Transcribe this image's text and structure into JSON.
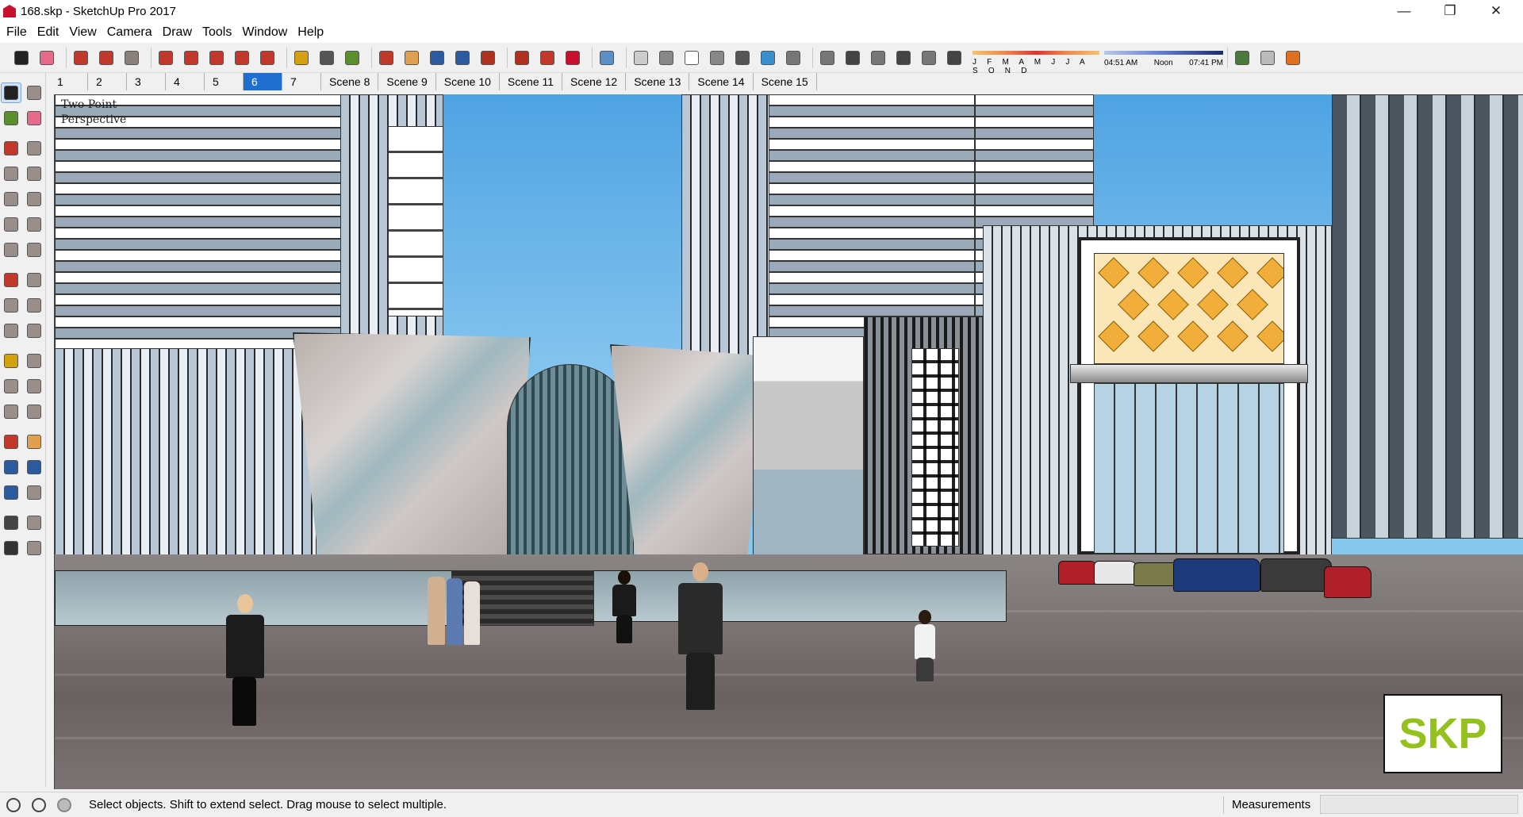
{
  "window": {
    "title": "168.skp - SketchUp Pro 2017",
    "minimize_glyph": "—",
    "maximize_glyph": "❐",
    "close_glyph": "✕"
  },
  "menu": [
    "File",
    "Edit",
    "View",
    "Camera",
    "Draw",
    "Tools",
    "Window",
    "Help"
  ],
  "toolbar": {
    "icons": [
      {
        "name": "select-icon",
        "color": "#222222"
      },
      {
        "name": "eraser-icon",
        "color": "#e46b8a"
      },
      {
        "name": "line-icon",
        "color": "#c0392b"
      },
      {
        "name": "arc-icon",
        "color": "#c0392b"
      },
      {
        "name": "rectangle-icon",
        "color": "#8a7f7b"
      },
      {
        "name": "push-pull-icon",
        "color": "#c0392b"
      },
      {
        "name": "follow-me-icon",
        "color": "#c0392b"
      },
      {
        "name": "move-icon",
        "color": "#c0392b"
      },
      {
        "name": "rotate-icon",
        "color": "#c0392b"
      },
      {
        "name": "scale-icon",
        "color": "#c0392b"
      },
      {
        "name": "tape-measure-icon",
        "color": "#d4a10f"
      },
      {
        "name": "text-icon",
        "color": "#555555"
      },
      {
        "name": "paint-bucket-icon",
        "color": "#5a8f2e"
      },
      {
        "name": "orbit-icon",
        "color": "#c0392b"
      },
      {
        "name": "pan-icon",
        "color": "#e0a050"
      },
      {
        "name": "zoom-icon",
        "color": "#2c5aa0"
      },
      {
        "name": "zoom-extents-icon",
        "color": "#2c5aa0"
      },
      {
        "name": "warehouse-icon",
        "color": "#b03020"
      },
      {
        "name": "extension-warehouse-icon",
        "color": "#b03020"
      },
      {
        "name": "layout-icon",
        "color": "#c0392b"
      },
      {
        "name": "ruby-icon",
        "color": "#c8102e"
      },
      {
        "name": "xray-icon",
        "color": "#5a8fc8"
      },
      {
        "name": "back-edges-icon",
        "color": "#cccccc"
      },
      {
        "name": "wireframe-icon",
        "color": "#888888"
      },
      {
        "name": "hidden-line-icon",
        "color": "#ffffff"
      },
      {
        "name": "shaded-icon",
        "color": "#888888"
      },
      {
        "name": "shaded-textures-icon",
        "color": "#555555"
      },
      {
        "name": "monochrome-icon",
        "color": "#3a8fd0"
      },
      {
        "name": "iso-view-icon",
        "color": "#777777"
      },
      {
        "name": "top-view-icon",
        "color": "#777777"
      },
      {
        "name": "front-view-icon",
        "color": "#444444"
      },
      {
        "name": "right-view-icon",
        "color": "#777777"
      },
      {
        "name": "back-view-icon",
        "color": "#444444"
      },
      {
        "name": "left-view-icon",
        "color": "#777777"
      },
      {
        "name": "shadows-toggle-icon",
        "color": "#444444"
      }
    ],
    "shadow_months": "J F M A M J J A S O N D",
    "shadow_time_start": "04:51 AM",
    "shadow_time_noon": "Noon",
    "shadow_time_end": "07:41 PM",
    "trailing_icons": [
      {
        "name": "geolocation-icon",
        "color": "#4a7a3a"
      },
      {
        "name": "tag-icon",
        "color": "#bbbbbb"
      },
      {
        "name": "add-location-icon",
        "color": "#e07020"
      }
    ]
  },
  "left_tools": [
    [
      "select-tool-icon",
      "component-tool-icon"
    ],
    [
      "paint-tool-icon",
      "eraser-tool-icon"
    ],
    [
      "line-tool-icon",
      "freehand-tool-icon"
    ],
    [
      "rectangle-tool-icon",
      "rotated-rectangle-tool-icon"
    ],
    [
      "circle-tool-icon",
      "polygon-tool-icon"
    ],
    [
      "arc-tool-icon",
      "two-point-arc-tool-icon"
    ],
    [
      "three-point-arc-tool-icon",
      "pie-tool-icon"
    ],
    [
      "move-tool-icon",
      "push-pull-tool-icon"
    ],
    [
      "rotate-tool-icon",
      "follow-me-tool-icon"
    ],
    [
      "scale-tool-icon",
      "offset-tool-icon"
    ],
    [
      "tape-tool-icon",
      "dimension-tool-icon"
    ],
    [
      "protractor-tool-icon",
      "text-tool-icon"
    ],
    [
      "axes-tool-icon",
      "3d-text-tool-icon"
    ],
    [
      "orbit-tool-icon",
      "pan-tool-icon"
    ],
    [
      "zoom-tool-icon",
      "zoom-window-tool-icon"
    ],
    [
      "zoom-extents-tool-icon",
      "previous-view-tool-icon"
    ],
    [
      "position-camera-tool-icon",
      "look-around-tool-icon"
    ],
    [
      "walk-tool-icon",
      "section-plane-tool-icon"
    ]
  ],
  "scenes": [
    "1",
    "2",
    "3",
    "4",
    "5",
    "6",
    "7",
    "Scene 8",
    "Scene 9",
    "Scene 10",
    "Scene 11",
    "Scene 12",
    "Scene 13",
    "Scene 14",
    "Scene 15"
  ],
  "active_scene": "6",
  "viewport": {
    "camera_label_line1": "Two Point",
    "camera_label_line2": "Perspective",
    "logo_text": "SKP"
  },
  "status": {
    "message": "Select objects. Shift to extend select. Drag mouse to select multiple.",
    "measurements_label": "Measurements",
    "measurements_value": ""
  }
}
